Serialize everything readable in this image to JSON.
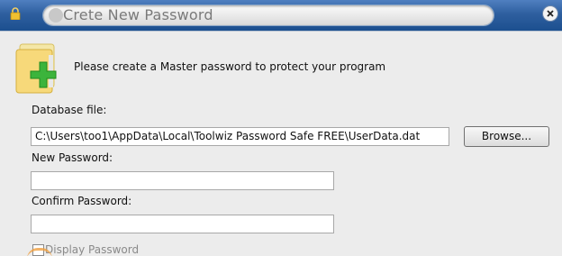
{
  "window": {
    "title": "Crete New Password",
    "icons": {
      "lock": "lock-icon",
      "close": "close-icon",
      "header": "folder-add-icon"
    }
  },
  "intro": {
    "message": "Please create a Master password to protect your program"
  },
  "database": {
    "label": "Database file:",
    "value": "C:\\Users\\too1\\AppData\\Local\\Toolwiz Password Safe FREE\\UserData.dat",
    "browse_label": "Browse..."
  },
  "new_password": {
    "label": "New Password:",
    "value": ""
  },
  "confirm_password": {
    "label": "Confirm Password:",
    "value": ""
  },
  "display_password": {
    "label": "Display Password",
    "checked": false
  },
  "colors": {
    "titlebar": "#2e5f9f",
    "background": "#ececec",
    "accent_green": "#3cb43c"
  }
}
